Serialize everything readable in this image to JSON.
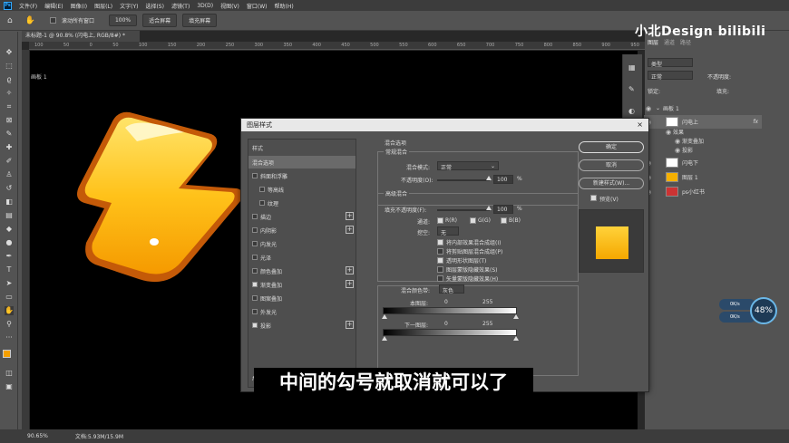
{
  "menubar": {
    "items": [
      "文件(F)",
      "编辑(E)",
      "图像(I)",
      "图层(L)",
      "文字(Y)",
      "选择(S)",
      "滤镜(T)",
      "3D(D)",
      "视图(V)",
      "窗口(W)",
      "帮助(H)"
    ]
  },
  "optbar": {
    "scroll_all_label": "滚动所有窗口",
    "zoom_value": "100%",
    "fit_screen": "适合屏幕",
    "fill_screen": "填充屏幕"
  },
  "document": {
    "tab_title": "未标题-1 @ 90.8% (闪电上, RGB/8#) *",
    "artboard_label": "画板 1",
    "ruler_ticks": [
      "100",
      "50",
      "0",
      "50",
      "100",
      "150",
      "200",
      "250",
      "300",
      "350",
      "400",
      "450",
      "500",
      "550",
      "600",
      "650",
      "700",
      "750",
      "800",
      "850",
      "900",
      "950"
    ]
  },
  "statusbar": {
    "zoom": "90.65%",
    "doc_size": "文档:5.93M/15.9M"
  },
  "layers_panel": {
    "tabs": [
      "图层",
      "通道",
      "路径"
    ],
    "kind_label": "类型",
    "blend_label": "正常",
    "opacity_label": "不透明度:",
    "lock_label": "锁定:",
    "fill_label": "填充:",
    "artboard_group": "画板 1",
    "layers": [
      {
        "name": "闪电上",
        "has_fx": true
      },
      {
        "name": "效果"
      },
      {
        "name": "渐变叠加"
      },
      {
        "name": "投影"
      },
      {
        "name": "闪电下"
      },
      {
        "name": "图层 1"
      },
      {
        "name": "ps小红书"
      }
    ],
    "fx_label": "fx"
  },
  "dialog": {
    "title": "图层样式",
    "close": "×",
    "styles_header": "样式",
    "style_items": [
      {
        "label": "混合选项",
        "selected": true,
        "checkbox": false,
        "plus": false
      },
      {
        "label": "斜面和浮雕",
        "checked": false,
        "checkbox": true,
        "plus": false
      },
      {
        "label": "等高线",
        "checked": false,
        "checkbox": true,
        "plus": false,
        "indent": true
      },
      {
        "label": "纹理",
        "checked": false,
        "checkbox": true,
        "plus": false,
        "indent": true
      },
      {
        "label": "描边",
        "checked": false,
        "checkbox": true,
        "plus": true
      },
      {
        "label": "内阴影",
        "checked": false,
        "checkbox": true,
        "plus": true
      },
      {
        "label": "内发光",
        "checked": false,
        "checkbox": true,
        "plus": false
      },
      {
        "label": "光泽",
        "checked": false,
        "checkbox": true,
        "plus": false
      },
      {
        "label": "颜色叠加",
        "checked": false,
        "checkbox": true,
        "plus": true
      },
      {
        "label": "渐变叠加",
        "checked": true,
        "checkbox": true,
        "plus": true
      },
      {
        "label": "图案叠加",
        "checked": false,
        "checkbox": true,
        "plus": false
      },
      {
        "label": "外发光",
        "checked": false,
        "checkbox": true,
        "plus": false
      },
      {
        "label": "投影",
        "checked": true,
        "checkbox": true,
        "plus": true
      }
    ],
    "blend_options_header": "混合选项",
    "general_blend_header": "常规混合",
    "blend_mode_label": "混合模式:",
    "blend_mode_value": "正常",
    "opacity_label": "不透明度(O):",
    "opacity_value": "100",
    "percent": "%",
    "advanced_header": "高级混合",
    "fill_opacity_label": "填充不透明度(F):",
    "fill_opacity_value": "100",
    "channels_label": "通道:",
    "channel_r": "R(R)",
    "channel_g": "G(G)",
    "channel_b": "B(B)",
    "knockout_label": "挖空:",
    "knockout_value": "无",
    "adv_checks": [
      {
        "label": "将内部效果混合成组(I)",
        "checked": true
      },
      {
        "label": "将剪贴图层混合成组(P)",
        "checked": false
      },
      {
        "label": "透明形状图层(T)",
        "checked": true
      },
      {
        "label": "图层蒙版隐藏效果(S)",
        "checked": false
      },
      {
        "label": "矢量蒙版隐藏效果(H)",
        "checked": false
      }
    ],
    "blend_if_label": "混合颜色带:",
    "blend_if_value": "灰色",
    "this_layer_label": "本图层:",
    "under_layer_label": "下一图层:",
    "range_min": "0",
    "range_max": "255",
    "btn_ok": "确定",
    "btn_cancel": "取消",
    "btn_new_style": "新建样式(W)...",
    "preview_label": "预览(V)",
    "fx_bottom": "fx"
  },
  "subtitle": "中间的勾号就取消就可以了",
  "watermark": "小北Design bilibili",
  "net_widget": {
    "up": "0K/s",
    "down": "0K/s",
    "percent": "48%"
  },
  "colors": {
    "accent_blue": "#31a8ff",
    "bolt_yellow": "#ffc21a",
    "bolt_orange": "#e0760a"
  }
}
